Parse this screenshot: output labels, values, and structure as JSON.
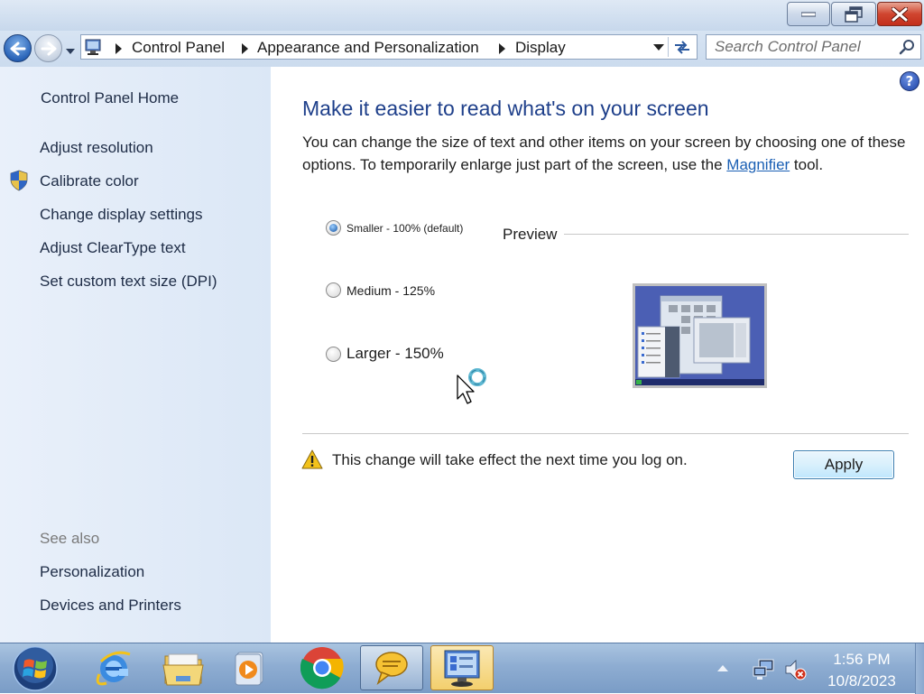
{
  "window": {
    "minimize_label": "",
    "maximize_label": "",
    "close_label": ""
  },
  "addressbar": {
    "crumbs": [
      "Control Panel",
      "Appearance and Personalization",
      "Display"
    ]
  },
  "search": {
    "placeholder": "Search Control Panel"
  },
  "sidebar": {
    "home": "Control Panel Home",
    "links": [
      "Adjust resolution",
      "Calibrate color",
      "Change display settings",
      "Adjust ClearType text",
      "Set custom text size (DPI)"
    ],
    "see_also_title": "See also",
    "see_also": [
      "Personalization",
      "Devices and Printers"
    ]
  },
  "main": {
    "heading": "Make it easier to read what's on your screen",
    "description_before": "You can change the size of text and other items on your screen by choosing one of these options. To temporarily enlarge just part of the screen, use the ",
    "description_link": "Magnifier",
    "description_after": " tool.",
    "options": [
      {
        "label": "Smaller - 100% (default)",
        "checked": true
      },
      {
        "label": "Medium - 125%",
        "checked": false
      },
      {
        "label": "Larger - 150%",
        "checked": false
      }
    ],
    "preview_label": "Preview",
    "warning": "This change will take effect the next time you log on.",
    "apply_label": "Apply"
  },
  "taskbar": {
    "apps": [
      "internet-explorer",
      "windows-explorer",
      "media-player",
      "google-chrome",
      "messenger",
      "control-panel"
    ],
    "time": "1:56 PM",
    "date": "10/8/2023"
  },
  "colors": {
    "heading": "#1e3f8a",
    "link": "#1a5fb4",
    "sidebar_bg": "#e1ebf8",
    "taskbar": "#8eadd2"
  }
}
